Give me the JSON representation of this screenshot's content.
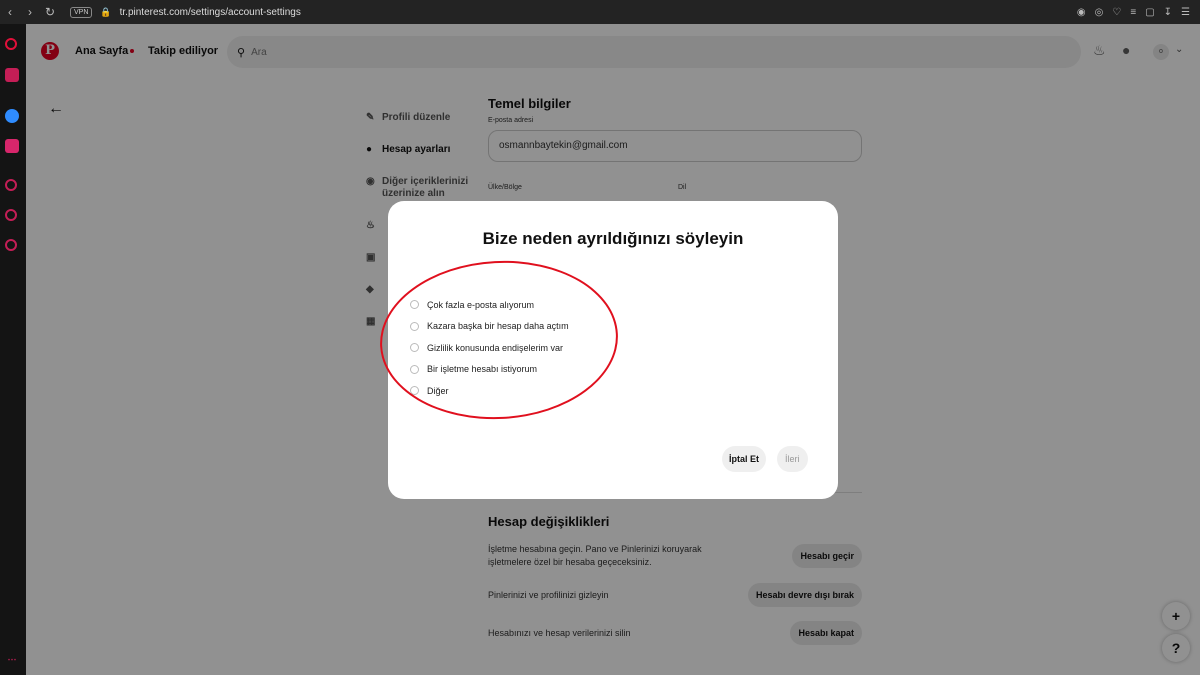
{
  "browser": {
    "url": "tr.pinterest.com/settings/account-settings",
    "vpn_label": "VPN"
  },
  "header": {
    "logo_letter": "P",
    "home": "Ana Sayfa",
    "following": "Takip ediliyor",
    "search_placeholder": "Ara",
    "avatar_letter": "o"
  },
  "settings_menu": {
    "items": [
      {
        "label": "Profili düzenle"
      },
      {
        "label": "Hesap ayarları"
      },
      {
        "label": "Diğer içeriklerinizi üzerinize alın"
      }
    ]
  },
  "basic_info": {
    "title": "Temel bilgiler",
    "email_label": "E-posta adresi",
    "email_value": "osmannbaytekin@gmail.com",
    "country_label": "Ülke/Bölge",
    "language_label": "Dil"
  },
  "account_changes": {
    "title": "Hesap değişiklikleri",
    "rows": [
      {
        "text": "İşletme hesabına geçin. Pano ve Pinlerinizi koruyarak işletmelere özel bir hesaba geçeceksiniz.",
        "button": "Hesabı geçir"
      },
      {
        "text": "Pinlerinizi ve profilinizi gizleyin",
        "button": "Hesabı devre dışı bırak"
      },
      {
        "text": "Hesabınızı ve hesap verilerinizi silin",
        "button": "Hesabı kapat"
      }
    ]
  },
  "modal": {
    "title": "Bize neden ayrıldığınızı söyleyin",
    "options": [
      "Çok fazla e-posta alıyorum",
      "Kazara başka bir hesap daha açtım",
      "Gizlilik konusunda endişelerim var",
      "Bir işletme hesabı istiyorum",
      "Diğer"
    ],
    "cancel": "İptal Et",
    "next": "İleri"
  },
  "fabs": {
    "plus": "+",
    "help": "?"
  },
  "colors": {
    "brand": "#e60023",
    "annotation_ring": "#e0101e"
  }
}
